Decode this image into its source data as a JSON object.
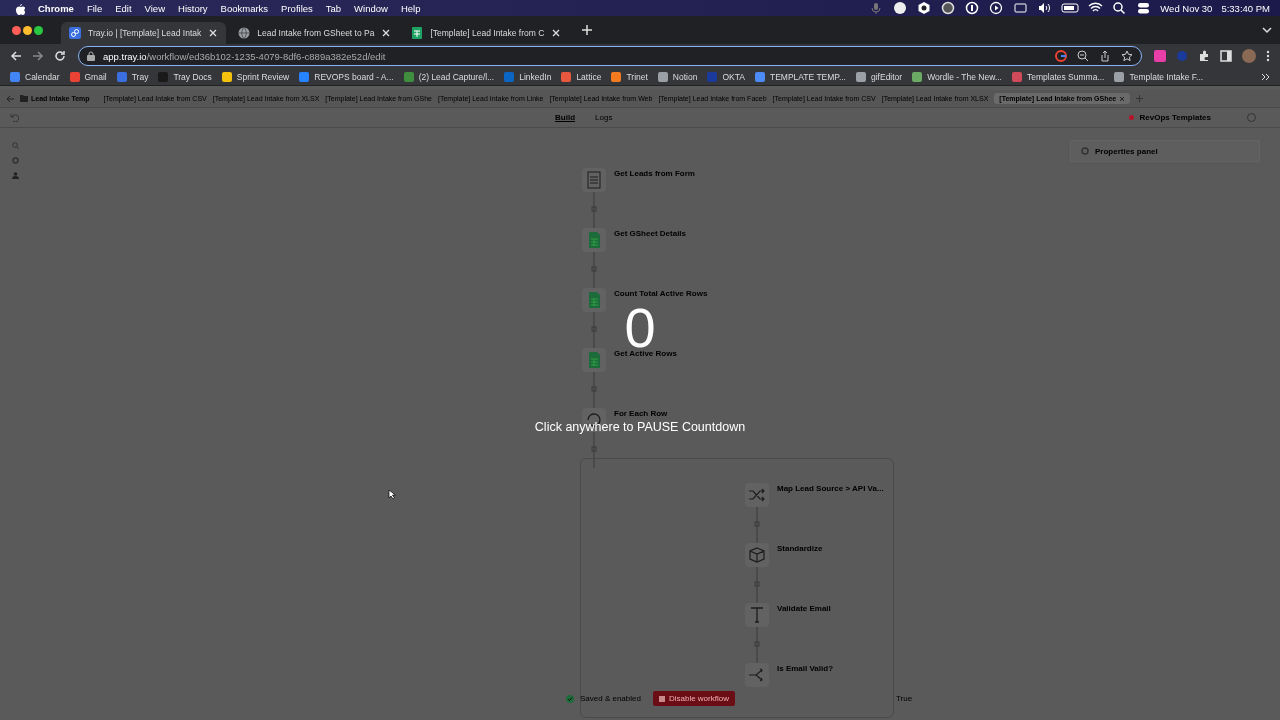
{
  "menu_bar": {
    "app": "Chrome",
    "items": [
      "File",
      "Edit",
      "View",
      "History",
      "Bookmarks",
      "Profiles",
      "Tab",
      "Window",
      "Help"
    ],
    "date": "Wed Nov 30",
    "time": "5:33:40 PM"
  },
  "browser_tabs": [
    {
      "title": "Tray.io | [Template] Lead Intak",
      "selected": true,
      "kind": "tray"
    },
    {
      "title": "Lead Intake from GSheet to Pa",
      "selected": false,
      "kind": "globe"
    },
    {
      "title": "[Template] Lead Intake from C",
      "selected": false,
      "kind": "sheet"
    }
  ],
  "address_bar": {
    "host": "app.tray.io",
    "path": "/workflow/ed36b102-1235-4079-8df6-c889a382e52d/edit"
  },
  "bookmarks": [
    {
      "label": "Calendar",
      "color": "#4285f4"
    },
    {
      "label": "Gmail",
      "color": "#ea4335"
    },
    {
      "label": "Tray",
      "color": "#3b6fe0"
    },
    {
      "label": "Tray Docs",
      "color": "#1a1a1a"
    },
    {
      "label": "Sprint Review",
      "color": "#f4c20d"
    },
    {
      "label": "REVOPS board - A...",
      "color": "#2684ff"
    },
    {
      "label": "(2) Lead Capture/l...",
      "color": "#3f8f3f"
    },
    {
      "label": "LinkedIn",
      "color": "#0a66c2"
    },
    {
      "label": "Lattice",
      "color": "#e8583f"
    },
    {
      "label": "Trinet",
      "color": "#f47a20"
    },
    {
      "label": "Notion",
      "color": "#9aa0a6"
    },
    {
      "label": "OKTA",
      "color": "#1a3a9c"
    },
    {
      "label": "TEMPLATE TEMP...",
      "color": "#4c8bf5"
    },
    {
      "label": "gifEditor",
      "color": "#9aa0a6"
    },
    {
      "label": "Wordle - The New...",
      "color": "#6aaa64"
    },
    {
      "label": "Templates Summa...",
      "color": "#d04a5a"
    },
    {
      "label": "Template Intake F...",
      "color": "#9aa0a6"
    }
  ],
  "app_tabs": [
    {
      "title": "Lead Intake Temp",
      "selected": false,
      "kind": "folder"
    },
    {
      "title": "[Template] Lead Intake from CSV",
      "selected": false,
      "kind": "tab"
    },
    {
      "title": "[Template] Lead Intake from XLSX",
      "selected": false,
      "kind": "tab"
    },
    {
      "title": "[Template] Lead Intake from GShe",
      "selected": false,
      "kind": "tab"
    },
    {
      "title": "[Template] Lead Intake from Linke",
      "selected": false,
      "kind": "tab"
    },
    {
      "title": "[Template] Lead Intake from Web",
      "selected": false,
      "kind": "tab"
    },
    {
      "title": "[Template] Lead Intake from Faceb",
      "selected": false,
      "kind": "tab"
    },
    {
      "title": "[Template] Lead Intake from CSV",
      "selected": false,
      "kind": "tab"
    },
    {
      "title": "[Template] Lead Intake from XLSX",
      "selected": false,
      "kind": "tab"
    },
    {
      "title": "[Template] Lead Intake from GShee",
      "selected": true,
      "kind": "tab"
    }
  ],
  "view_tabs": [
    {
      "label": "Build",
      "selected": true
    },
    {
      "label": "Logs",
      "selected": false
    }
  ],
  "project": {
    "label": "RevOps Templates",
    "color": "#b3142a"
  },
  "properties_panel": {
    "title": "Properties panel"
  },
  "workflow": [
    {
      "title": "Get Leads from Form",
      "kind": "form"
    },
    {
      "title": "Get GSheet Details",
      "kind": "sheet"
    },
    {
      "title": "Count Total Active Rows",
      "kind": "sheet"
    },
    {
      "title": "Get Active Rows",
      "kind": "sheet"
    },
    {
      "title": "For Each Row",
      "kind": "loop",
      "children": [
        {
          "title": "Map Lead Source > API Va...",
          "kind": "shuffle"
        },
        {
          "title": "Standardize",
          "kind": "cube"
        },
        {
          "title": "Validate Email",
          "kind": "text"
        },
        {
          "title": "Is Email Valid?",
          "kind": "branch"
        }
      ]
    }
  ],
  "branch_label": "True",
  "status": {
    "label": "Saved & enabled",
    "enabled": true
  },
  "disable_button": "Disable workflow",
  "countdown": {
    "number": "0",
    "message": "Click anywhere to PAUSE Countdown"
  }
}
